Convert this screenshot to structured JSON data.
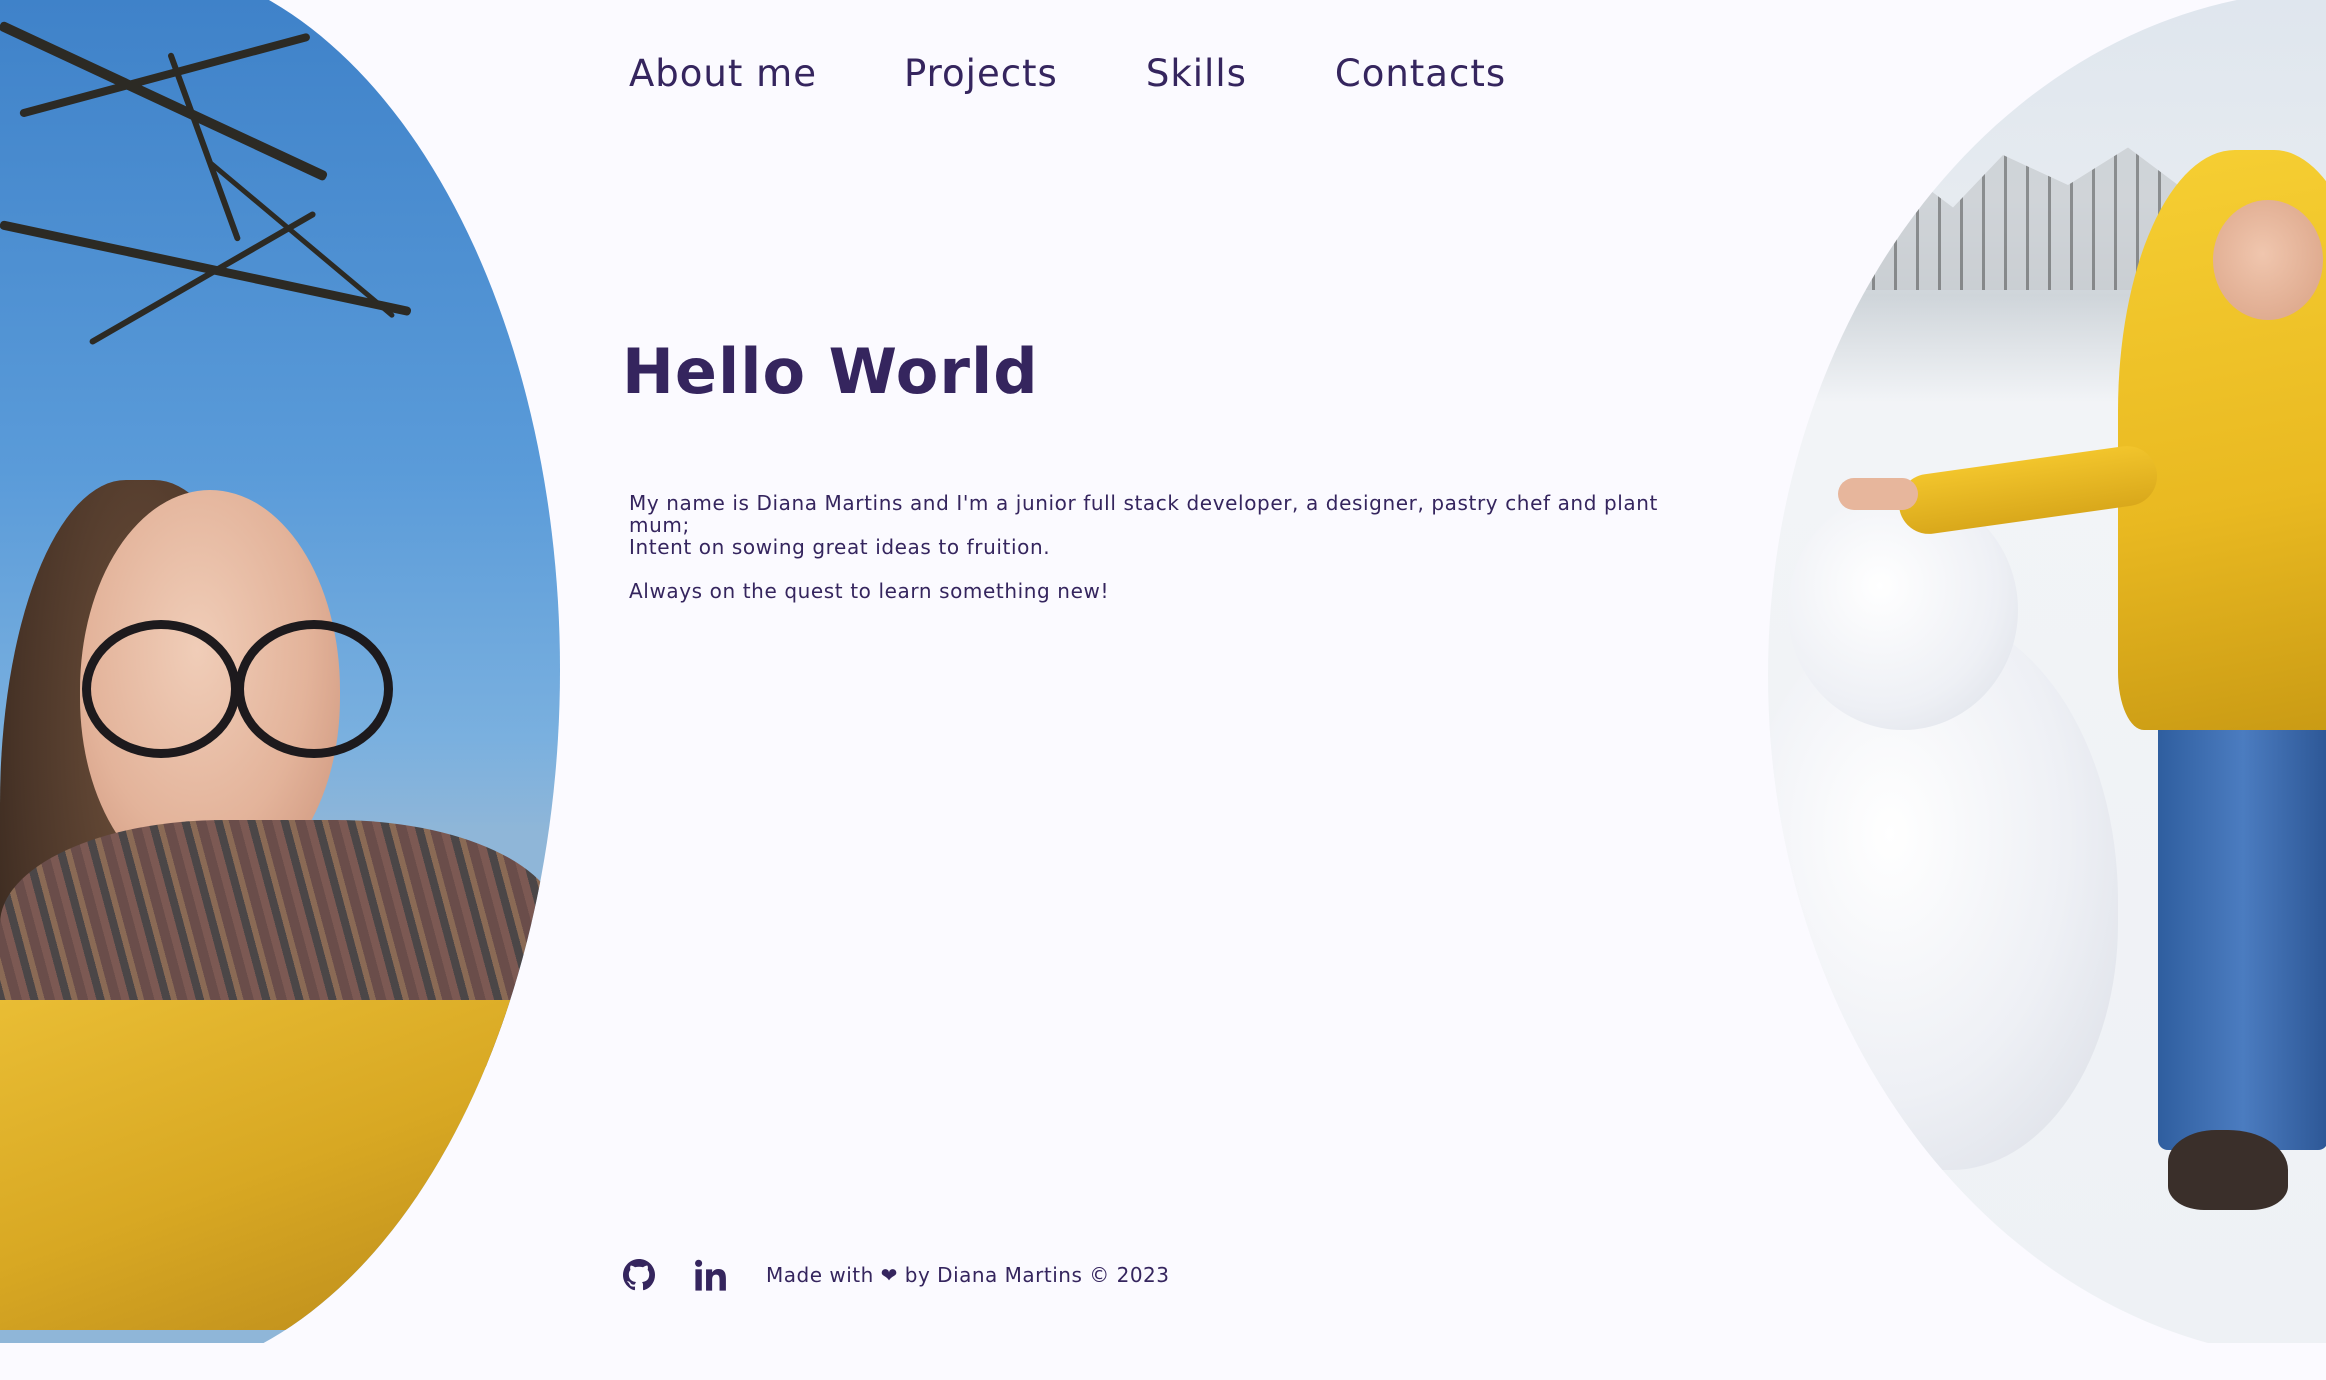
{
  "nav": {
    "about": "About me",
    "projects": "Projects",
    "skills": "Skills",
    "contacts": "Contacts"
  },
  "hero": {
    "title": "Hello World",
    "line1": "My name is Diana Martins and I'm a junior full stack developer, a designer, pastry chef and plant mum;",
    "line2": "Intent on sowing great ideas to fruition.",
    "line3": "Always on the quest to learn something new!"
  },
  "footer": {
    "text": "Made with ❤ by Diana Martins © 2023"
  },
  "icons": {
    "github": "github-icon",
    "linkedin": "linkedin-icon"
  },
  "colors": {
    "text": "#35255e",
    "background": "#fbfaff"
  }
}
